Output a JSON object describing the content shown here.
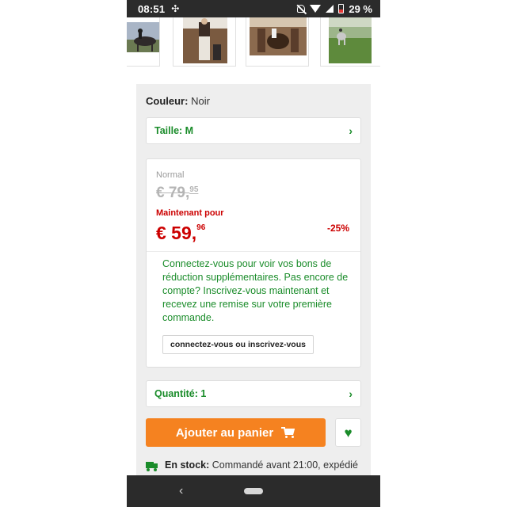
{
  "status_bar": {
    "time": "08:51",
    "battery": "29 %",
    "icons": [
      "fan-icon",
      "bell-off-icon",
      "wifi-icon",
      "signal-icon",
      "battery-icon"
    ]
  },
  "gallery": {
    "thumbnails": [
      {
        "name": "rider-jumping-thumbnail",
        "colors": [
          "#6b7a52",
          "#2f2a2a",
          "#a9b5c6"
        ]
      },
      {
        "name": "rider-standing-thumbnail",
        "colors": [
          "#3b2c25",
          "#e9e4dc",
          "#7a5a40"
        ]
      },
      {
        "name": "horse-stable-thumbnail",
        "colors": [
          "#5a3d2b",
          "#8b6a4e",
          "#d6c6b0"
        ]
      },
      {
        "name": "horse-arena-thumbnail",
        "colors": [
          "#5e8a3c",
          "#c9c9c9",
          "#9db58a"
        ]
      }
    ]
  },
  "product": {
    "color_label": "Couleur:",
    "color_value": "Noir",
    "size_label": "Taille: M",
    "normal_label": "Normal",
    "old_price": "€ 79,",
    "old_price_cents": "95",
    "now_label": "Maintenant pour",
    "new_price": "€ 59,",
    "new_price_cents": "96",
    "discount": "-25%",
    "login_text": "Connectez-vous pour voir vos bons de réduction supplémentaires. Pas encore de compte? Inscrivez-vous maintenant et recevez une remise sur votre première commande.",
    "login_button": "connectez-vous ou inscrivez-vous",
    "quantity_label": "Quantité: 1",
    "add_to_cart": "Ajouter au panier",
    "stock_label": "En stock:",
    "stock_text": "Commandé avant 21:00, expédié"
  },
  "colors": {
    "accent_green": "#1a8c2a",
    "accent_orange": "#f58220",
    "price_red": "#cc0000"
  }
}
